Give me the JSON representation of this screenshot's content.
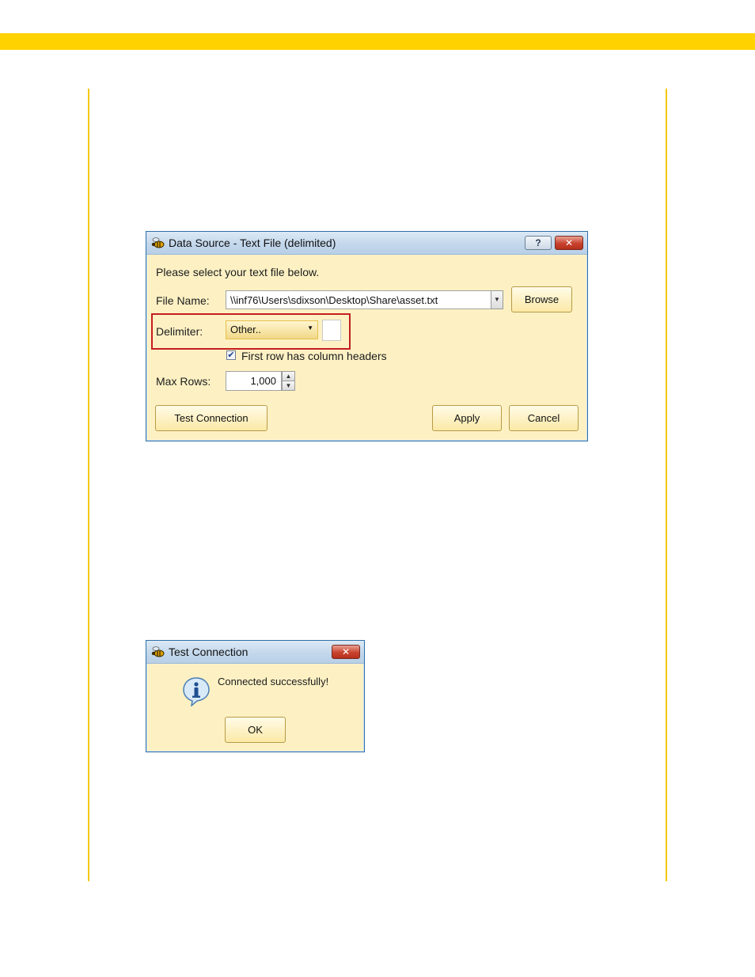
{
  "data_source_dialog": {
    "title": "Data Source - Text File (delimited)",
    "help_label": "?",
    "close_label": "✕",
    "instruction": "Please select your text file below.",
    "file_name_label": "File Name:",
    "file_name_value": "\\\\inf76\\Users\\sdixson\\Desktop\\Share\\asset.txt",
    "browse_label": "Browse",
    "delimiter_label": "Delimiter:",
    "delimiter_value": "Other..",
    "custom_delimiter_value": "",
    "first_row_headers_label": "First row has column headers",
    "first_row_headers_checked": true,
    "max_rows_label": "Max Rows:",
    "max_rows_value": "1,000",
    "test_connection_label": "Test Connection",
    "apply_label": "Apply",
    "cancel_label": "Cancel"
  },
  "test_connection_dialog": {
    "title": "Test Connection",
    "close_label": "✕",
    "message": "Connected successfully!",
    "ok_label": "OK"
  },
  "colors": {
    "accent_yellow": "#ffd200",
    "dialog_background": "#fdf1c4",
    "highlight_red": "#c41e1e"
  }
}
